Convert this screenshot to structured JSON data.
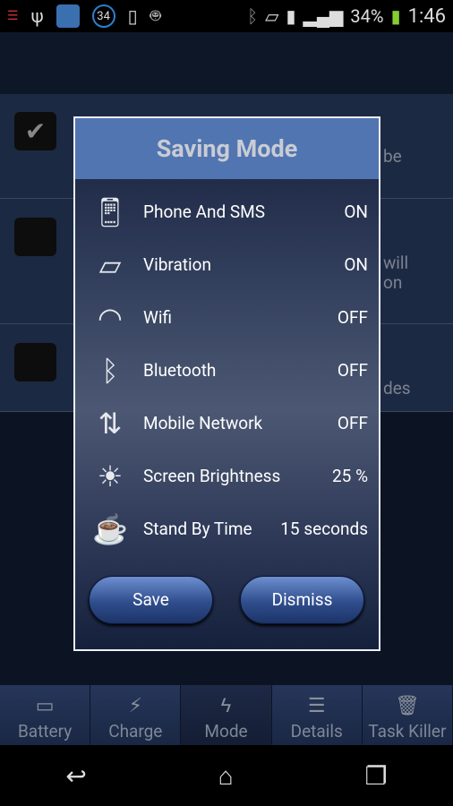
{
  "status_bar": {
    "notification_badge": "34",
    "battery": "34%",
    "time": "1:46"
  },
  "background_fragments": [
    "be",
    "will",
    "on",
    "des"
  ],
  "dialog": {
    "title": "Saving Mode",
    "items": [
      {
        "icon": "phone-icon",
        "label": "Phone And SMS",
        "value": "ON"
      },
      {
        "icon": "vibration-icon",
        "label": "Vibration",
        "value": "ON"
      },
      {
        "icon": "wifi-icon",
        "label": "Wifi",
        "value": "OFF"
      },
      {
        "icon": "bluetooth-icon",
        "label": "Bluetooth",
        "value": "OFF"
      },
      {
        "icon": "mobile-network-icon",
        "label": "Mobile Network",
        "value": "OFF"
      },
      {
        "icon": "brightness-icon",
        "label": "Screen Brightness",
        "value": "25 %"
      },
      {
        "icon": "coffee-cup-icon",
        "label": "Stand By Time",
        "value": "15 seconds"
      }
    ],
    "save_label": "Save",
    "dismiss_label": "Dismiss"
  },
  "tabs": [
    {
      "label": "Battery"
    },
    {
      "label": "Charge"
    },
    {
      "label": "Mode",
      "active": true
    },
    {
      "label": "Details"
    },
    {
      "label": "Task Killer"
    }
  ],
  "colors": {
    "header": "#5175b1",
    "accent_button": "#2f4d8c"
  }
}
